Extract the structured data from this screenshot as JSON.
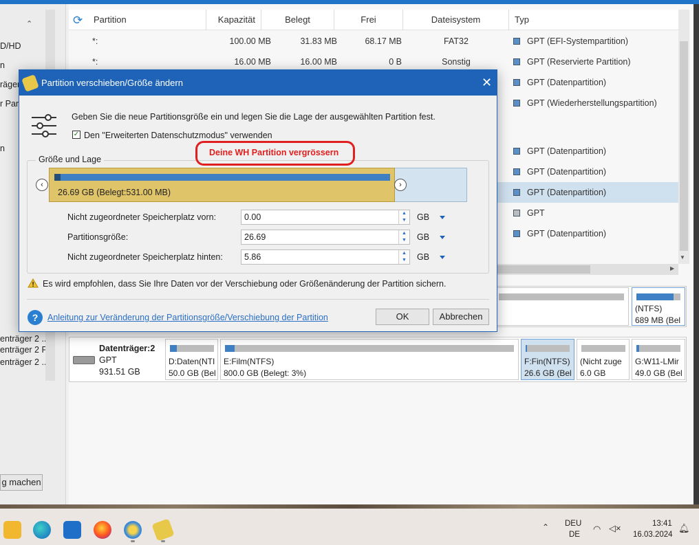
{
  "left_panel": {
    "items": [
      "D/HD",
      "n",
      "räger",
      "r Part",
      "n"
    ],
    "disk_items": [
      "enträger 2 ...",
      "enträger 2 P...",
      "enträger 2 ..."
    ],
    "button_label": "g machen"
  },
  "table": {
    "columns": [
      "Partition",
      "Kapazität",
      "Belegt",
      "Frei",
      "Dateisystem",
      "Typ"
    ],
    "rows": [
      {
        "partition": "*:",
        "kapazitaet": "100.00 MB",
        "belegt": "31.83 MB",
        "frei": "68.17 MB",
        "dateisystem": "FAT32",
        "typ": "GPT (EFI-Systempartition)"
      },
      {
        "partition": "*:",
        "kapazitaet": "16.00 MB",
        "belegt": "16.00 MB",
        "frei": "0 B",
        "dateisystem": "Sonstig",
        "typ": "GPT (Reservierte Partition)"
      },
      {
        "typ": "GPT (Datenpartition)"
      },
      {
        "typ": "GPT (Wiederherstellungspartition)"
      },
      {
        "typ": "GPT (Datenpartition)"
      },
      {
        "typ": "GPT (Datenpartition)"
      },
      {
        "typ": "GPT (Datenpartition)"
      },
      {
        "typ": "GPT"
      },
      {
        "typ": "GPT (Datenpartition)"
      }
    ]
  },
  "disk1": {
    "last_part": {
      "line1": "(NTFS)",
      "line2": "689 MB (Bel"
    }
  },
  "disk2": {
    "name": "Datenträger:2",
    "scheme": "GPT",
    "size": "931.51 GB",
    "partitions": [
      {
        "line1": "D:Daten(NTI",
        "line2": "50.0 GB (Bel",
        "fill": 0.15
      },
      {
        "line1": "E:Film(NTFS)",
        "line2": "800.0 GB (Belegt: 3%)",
        "fill": 0.03
      },
      {
        "line1": "F:Fin(NTFS)",
        "line2": "26.6 GB (Bel",
        "fill": 0.02
      },
      {
        "line1": "(Nicht zuge",
        "line2": "6.0 GB",
        "fill": 0
      },
      {
        "line1": "G:W11-LMir",
        "line2": "49.0 GB (Bel",
        "fill": 0.05
      }
    ]
  },
  "dialog": {
    "title": "Partition verschieben/Größe ändern",
    "description": "Geben Sie die neue Partitionsgröße ein und legen Sie die Lage der ausgewählten Partition fest.",
    "checkbox_label": "Den \"Erweiterten Datenschutzmodus\" verwenden",
    "annotation": "Deine WH Partition vergrössern",
    "group_title": "Größe und Lage",
    "partition_bar_label": "26.69 GB (Belegt:531.00 MB)",
    "fields": [
      {
        "label": "Nicht zugeordneter Speicherplatz vorn:",
        "value": "0.00",
        "unit": "GB"
      },
      {
        "label": "Partitionsgröße:",
        "value": "26.69",
        "unit": "GB"
      },
      {
        "label": "Nicht zugeordneter Speicherplatz hinten:",
        "value": "5.86",
        "unit": "GB"
      }
    ],
    "warning": "Es wird empfohlen, dass Sie Ihre Daten vor der Verschiebung oder Größenänderung der Partition sichern.",
    "help_link": "Anleitung zur Veränderung der Partitionsgröße/Verschiebung der Partition",
    "ok_label": "OK",
    "cancel_label": "Abbrechen"
  },
  "taskbar": {
    "lang1": "DEU",
    "lang2": "DE",
    "time": "13:41",
    "date": "16.03.2024"
  },
  "colors": {
    "accent": "#1f63b8",
    "partition_gold": "#e0c46a",
    "annotation_red": "#e02020"
  }
}
